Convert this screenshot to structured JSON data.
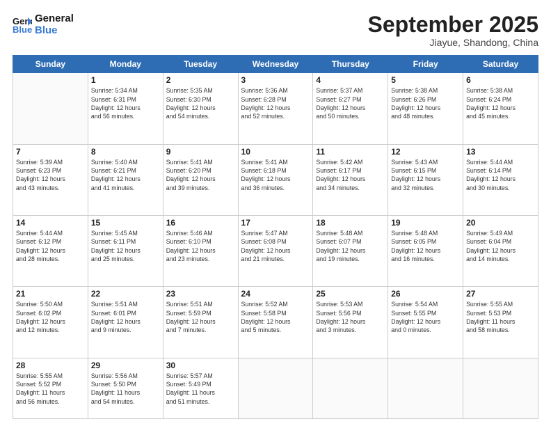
{
  "header": {
    "logo_line1": "General",
    "logo_line2": "Blue",
    "month": "September 2025",
    "location": "Jiayue, Shandong, China"
  },
  "days_of_week": [
    "Sunday",
    "Monday",
    "Tuesday",
    "Wednesday",
    "Thursday",
    "Friday",
    "Saturday"
  ],
  "weeks": [
    [
      {
        "day": "",
        "content": ""
      },
      {
        "day": "1",
        "content": "Sunrise: 5:34 AM\nSunset: 6:31 PM\nDaylight: 12 hours\nand 56 minutes."
      },
      {
        "day": "2",
        "content": "Sunrise: 5:35 AM\nSunset: 6:30 PM\nDaylight: 12 hours\nand 54 minutes."
      },
      {
        "day": "3",
        "content": "Sunrise: 5:36 AM\nSunset: 6:28 PM\nDaylight: 12 hours\nand 52 minutes."
      },
      {
        "day": "4",
        "content": "Sunrise: 5:37 AM\nSunset: 6:27 PM\nDaylight: 12 hours\nand 50 minutes."
      },
      {
        "day": "5",
        "content": "Sunrise: 5:38 AM\nSunset: 6:26 PM\nDaylight: 12 hours\nand 48 minutes."
      },
      {
        "day": "6",
        "content": "Sunrise: 5:38 AM\nSunset: 6:24 PM\nDaylight: 12 hours\nand 45 minutes."
      }
    ],
    [
      {
        "day": "7",
        "content": "Sunrise: 5:39 AM\nSunset: 6:23 PM\nDaylight: 12 hours\nand 43 minutes."
      },
      {
        "day": "8",
        "content": "Sunrise: 5:40 AM\nSunset: 6:21 PM\nDaylight: 12 hours\nand 41 minutes."
      },
      {
        "day": "9",
        "content": "Sunrise: 5:41 AM\nSunset: 6:20 PM\nDaylight: 12 hours\nand 39 minutes."
      },
      {
        "day": "10",
        "content": "Sunrise: 5:41 AM\nSunset: 6:18 PM\nDaylight: 12 hours\nand 36 minutes."
      },
      {
        "day": "11",
        "content": "Sunrise: 5:42 AM\nSunset: 6:17 PM\nDaylight: 12 hours\nand 34 minutes."
      },
      {
        "day": "12",
        "content": "Sunrise: 5:43 AM\nSunset: 6:15 PM\nDaylight: 12 hours\nand 32 minutes."
      },
      {
        "day": "13",
        "content": "Sunrise: 5:44 AM\nSunset: 6:14 PM\nDaylight: 12 hours\nand 30 minutes."
      }
    ],
    [
      {
        "day": "14",
        "content": "Sunrise: 5:44 AM\nSunset: 6:12 PM\nDaylight: 12 hours\nand 28 minutes."
      },
      {
        "day": "15",
        "content": "Sunrise: 5:45 AM\nSunset: 6:11 PM\nDaylight: 12 hours\nand 25 minutes."
      },
      {
        "day": "16",
        "content": "Sunrise: 5:46 AM\nSunset: 6:10 PM\nDaylight: 12 hours\nand 23 minutes."
      },
      {
        "day": "17",
        "content": "Sunrise: 5:47 AM\nSunset: 6:08 PM\nDaylight: 12 hours\nand 21 minutes."
      },
      {
        "day": "18",
        "content": "Sunrise: 5:48 AM\nSunset: 6:07 PM\nDaylight: 12 hours\nand 19 minutes."
      },
      {
        "day": "19",
        "content": "Sunrise: 5:48 AM\nSunset: 6:05 PM\nDaylight: 12 hours\nand 16 minutes."
      },
      {
        "day": "20",
        "content": "Sunrise: 5:49 AM\nSunset: 6:04 PM\nDaylight: 12 hours\nand 14 minutes."
      }
    ],
    [
      {
        "day": "21",
        "content": "Sunrise: 5:50 AM\nSunset: 6:02 PM\nDaylight: 12 hours\nand 12 minutes."
      },
      {
        "day": "22",
        "content": "Sunrise: 5:51 AM\nSunset: 6:01 PM\nDaylight: 12 hours\nand 9 minutes."
      },
      {
        "day": "23",
        "content": "Sunrise: 5:51 AM\nSunset: 5:59 PM\nDaylight: 12 hours\nand 7 minutes."
      },
      {
        "day": "24",
        "content": "Sunrise: 5:52 AM\nSunset: 5:58 PM\nDaylight: 12 hours\nand 5 minutes."
      },
      {
        "day": "25",
        "content": "Sunrise: 5:53 AM\nSunset: 5:56 PM\nDaylight: 12 hours\nand 3 minutes."
      },
      {
        "day": "26",
        "content": "Sunrise: 5:54 AM\nSunset: 5:55 PM\nDaylight: 12 hours\nand 0 minutes."
      },
      {
        "day": "27",
        "content": "Sunrise: 5:55 AM\nSunset: 5:53 PM\nDaylight: 11 hours\nand 58 minutes."
      }
    ],
    [
      {
        "day": "28",
        "content": "Sunrise: 5:55 AM\nSunset: 5:52 PM\nDaylight: 11 hours\nand 56 minutes."
      },
      {
        "day": "29",
        "content": "Sunrise: 5:56 AM\nSunset: 5:50 PM\nDaylight: 11 hours\nand 54 minutes."
      },
      {
        "day": "30",
        "content": "Sunrise: 5:57 AM\nSunset: 5:49 PM\nDaylight: 11 hours\nand 51 minutes."
      },
      {
        "day": "",
        "content": ""
      },
      {
        "day": "",
        "content": ""
      },
      {
        "day": "",
        "content": ""
      },
      {
        "day": "",
        "content": ""
      }
    ]
  ]
}
